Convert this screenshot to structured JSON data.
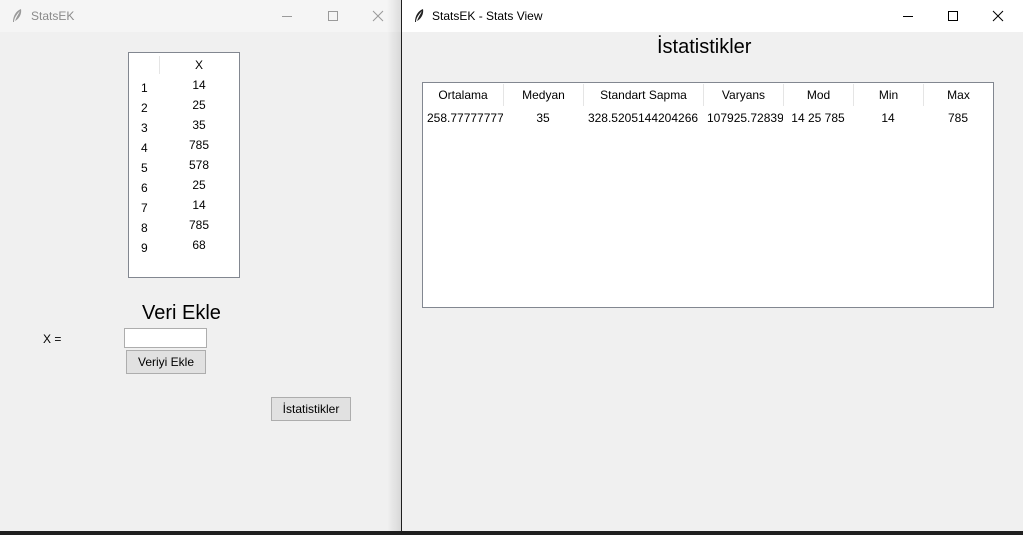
{
  "left_window": {
    "title": "StatsEK",
    "column_header": "X",
    "rows": [
      {
        "index": "1",
        "value": "14"
      },
      {
        "index": "2",
        "value": "25"
      },
      {
        "index": "3",
        "value": "35"
      },
      {
        "index": "4",
        "value": "785"
      },
      {
        "index": "5",
        "value": "578"
      },
      {
        "index": "6",
        "value": "25"
      },
      {
        "index": "7",
        "value": "14"
      },
      {
        "index": "8",
        "value": "785"
      },
      {
        "index": "9",
        "value": "68"
      }
    ],
    "add_heading": "Veri Ekle",
    "x_label": "X =",
    "x_input_value": "",
    "add_button": "Veriyi Ekle",
    "stats_button": "İstatistikler"
  },
  "right_window": {
    "title": "StatsEK - Stats View",
    "heading": "İstatistikler",
    "columns": [
      "Ortalama",
      "Medyan",
      "Standart Sapma",
      "Varyans",
      "Mod",
      "Min",
      "Max"
    ],
    "row": [
      "258.7777777777",
      "35",
      "328.5205144204266",
      "107925.728395",
      "14 25 785",
      "14",
      "785"
    ]
  },
  "icons": {
    "app": "feather-icon",
    "minimize": "minimize-icon",
    "maximize": "maximize-icon",
    "close": "close-icon"
  }
}
